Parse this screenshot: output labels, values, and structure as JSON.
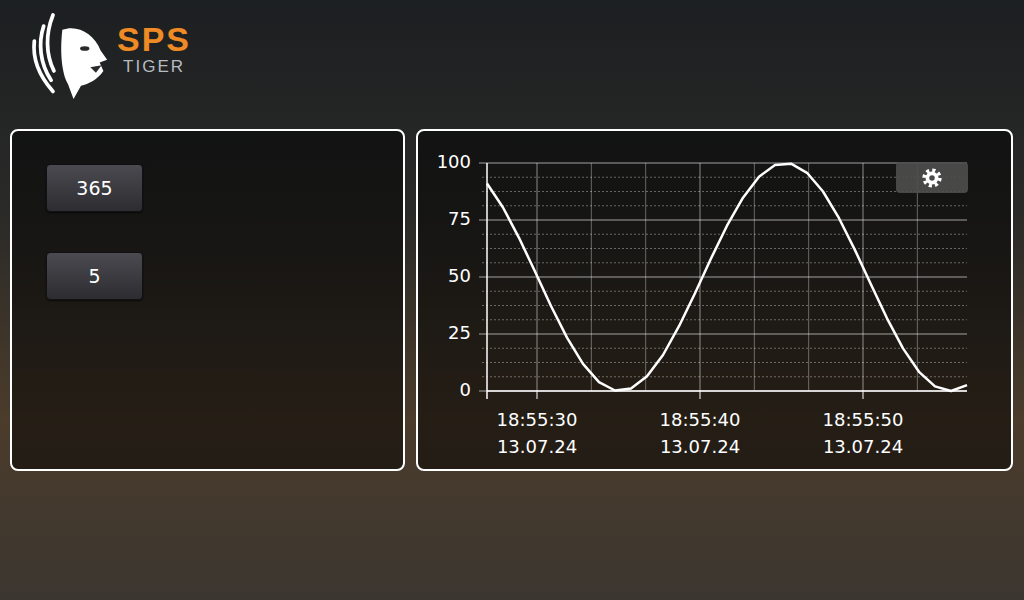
{
  "logo": {
    "brand": "SPS",
    "tagline": "TIGER"
  },
  "buttons": [
    {
      "label": "365"
    },
    {
      "label": "5"
    }
  ],
  "chart": {
    "y_ticks": [
      "100",
      "75",
      "50",
      "25",
      "0"
    ],
    "x_ticks": [
      {
        "time": "18:55:30",
        "date": "13.07.24"
      },
      {
        "time": "18:55:40",
        "date": "13.07.24"
      },
      {
        "time": "18:55:50",
        "date": "13.07.24"
      }
    ],
    "series": [
      {
        "values": [
          91.0,
          80.5,
          67.2,
          52.4,
          37.3,
          23.4,
          11.9,
          3.9,
          0.2,
          1.1,
          6.5,
          15.8,
          28.4,
          42.9,
          58.1,
          72.5,
          84.8,
          94.0,
          99.1,
          99.7,
          95.7,
          87.5,
          75.8,
          61.8,
          46.7,
          31.9,
          18.7,
          8.4,
          2.0,
          0.0,
          2.6
        ]
      }
    ]
  }
}
